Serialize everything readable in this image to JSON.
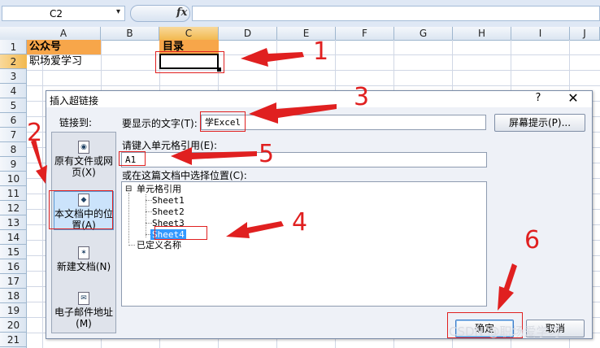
{
  "formula_bar": {
    "name_box": "C2",
    "name_dropdown": "▾",
    "fx": "fx",
    "formula": ""
  },
  "columns": [
    "A",
    "B",
    "C",
    "D",
    "E",
    "F",
    "G",
    "H",
    "I",
    "J"
  ],
  "rows": [
    "1",
    "2",
    "3",
    "4",
    "5",
    "6",
    "7",
    "8",
    "9",
    "10",
    "11",
    "12",
    "13",
    "14",
    "15",
    "16",
    "17",
    "18",
    "19",
    "20",
    "21"
  ],
  "cells": {
    "a1": "公众号",
    "c1": "目录",
    "a2": "职场爱学习"
  },
  "dialog": {
    "title": "插入超链接",
    "help": "?",
    "close": "✕",
    "link_to_label": "链接到:",
    "link_to_items": [
      "原有文件或网页(X)",
      "本文档中的位置(A)",
      "新建文档(N)",
      "电子邮件地址(M)"
    ],
    "display_text_label": "要显示的文字(T):",
    "display_text_value": "学Excel",
    "screentip_button": "屏幕提示(P)...",
    "cell_ref_label": "请键入单元格引用(E):",
    "cell_ref_value": "A1",
    "place_label": "或在这篇文档中选择位置(C):",
    "tree_root": "单元格引用",
    "tree_toggle": "⊟",
    "sheets": [
      "Sheet1",
      "Sheet2",
      "Sheet3",
      "Sheet4"
    ],
    "defined_names": "已定义名称",
    "ok_button": "确定",
    "cancel_button": "取消"
  },
  "annotations": [
    "1",
    "2",
    "3",
    "4",
    "5",
    "6"
  ],
  "watermark": "CSDN @职场爱学习",
  "colors": {
    "header_fill": "#f7a64a",
    "annotation": "#e02020",
    "selection": "#3399ff"
  }
}
